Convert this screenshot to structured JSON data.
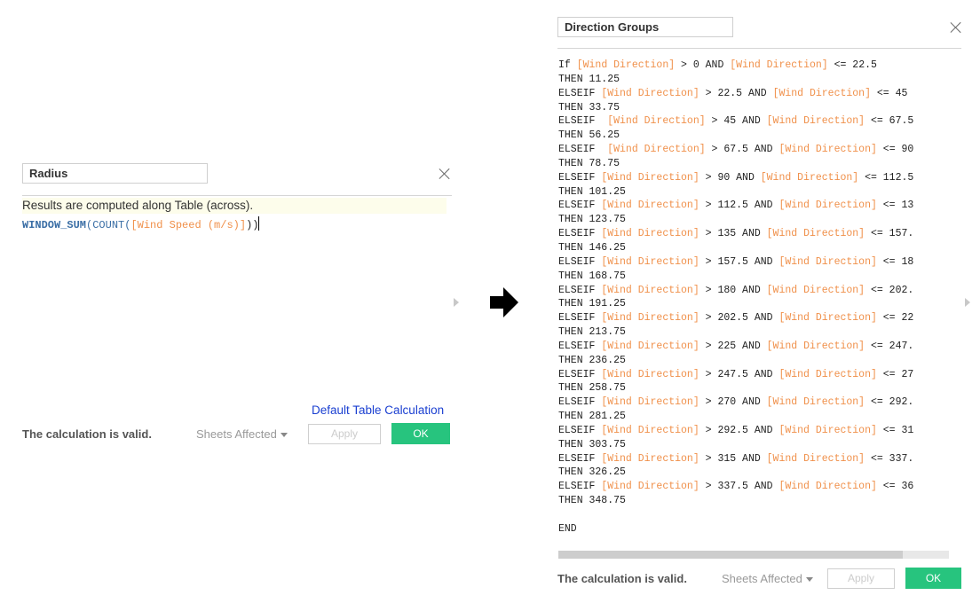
{
  "left_dialog": {
    "name_value": "Radius",
    "hint": "Results are computed along Table (across).",
    "formula": {
      "fn1": "WINDOW_SUM",
      "open1": "(",
      "fn2": "COUNT",
      "open2": "(",
      "field": "[Wind Speed (m/s)]",
      "close": "))"
    },
    "default_table_calc_link": "Default Table Calculation",
    "status": "The calculation is valid.",
    "sheets_affected": "Sheets Affected",
    "apply": "Apply",
    "ok": "OK"
  },
  "right_dialog": {
    "name_value": "Direction Groups",
    "code_lines": [
      [
        {
          "t": "If ",
          "c": "kw"
        },
        {
          "t": "[Wind Direction]",
          "c": "field"
        },
        {
          "t": " > 0 AND ",
          "c": "kw"
        },
        {
          "t": "[Wind Direction]",
          "c": "field"
        },
        {
          "t": " <= 22.5",
          "c": "kw"
        }
      ],
      [
        {
          "t": "THEN 11.25",
          "c": "kw"
        }
      ],
      [
        {
          "t": "ELSEIF ",
          "c": "kw"
        },
        {
          "t": "[Wind Direction]",
          "c": "field"
        },
        {
          "t": " > 22.5 AND ",
          "c": "kw"
        },
        {
          "t": "[Wind Direction]",
          "c": "field"
        },
        {
          "t": " <= 45",
          "c": "kw"
        }
      ],
      [
        {
          "t": "THEN 33.75",
          "c": "kw"
        }
      ],
      [
        {
          "t": "ELSEIF  ",
          "c": "kw"
        },
        {
          "t": "[Wind Direction]",
          "c": "field"
        },
        {
          "t": " > 45 AND ",
          "c": "kw"
        },
        {
          "t": "[Wind Direction]",
          "c": "field"
        },
        {
          "t": " <= 67.5",
          "c": "kw"
        }
      ],
      [
        {
          "t": "THEN 56.25",
          "c": "kw"
        }
      ],
      [
        {
          "t": "ELSEIF  ",
          "c": "kw"
        },
        {
          "t": "[Wind Direction]",
          "c": "field"
        },
        {
          "t": " > 67.5 AND ",
          "c": "kw"
        },
        {
          "t": "[Wind Direction]",
          "c": "field"
        },
        {
          "t": " <= 90",
          "c": "kw"
        }
      ],
      [
        {
          "t": "THEN 78.75",
          "c": "kw"
        }
      ],
      [
        {
          "t": "ELSEIF ",
          "c": "kw"
        },
        {
          "t": "[Wind Direction]",
          "c": "field"
        },
        {
          "t": " > 90 AND ",
          "c": "kw"
        },
        {
          "t": "[Wind Direction]",
          "c": "field"
        },
        {
          "t": " <= 112.5",
          "c": "kw"
        }
      ],
      [
        {
          "t": "THEN 101.25",
          "c": "kw"
        }
      ],
      [
        {
          "t": "ELSEIF ",
          "c": "kw"
        },
        {
          "t": "[Wind Direction]",
          "c": "field"
        },
        {
          "t": " > 112.5 AND ",
          "c": "kw"
        },
        {
          "t": "[Wind Direction]",
          "c": "field"
        },
        {
          "t": " <= 13",
          "c": "kw"
        }
      ],
      [
        {
          "t": "THEN 123.75",
          "c": "kw"
        }
      ],
      [
        {
          "t": "ELSEIF ",
          "c": "kw"
        },
        {
          "t": "[Wind Direction]",
          "c": "field"
        },
        {
          "t": " > 135 AND ",
          "c": "kw"
        },
        {
          "t": "[Wind Direction]",
          "c": "field"
        },
        {
          "t": " <= 157.",
          "c": "kw"
        }
      ],
      [
        {
          "t": "THEN 146.25",
          "c": "kw"
        }
      ],
      [
        {
          "t": "ELSEIF ",
          "c": "kw"
        },
        {
          "t": "[Wind Direction]",
          "c": "field"
        },
        {
          "t": " > 157.5 AND ",
          "c": "kw"
        },
        {
          "t": "[Wind Direction]",
          "c": "field"
        },
        {
          "t": " <= 18",
          "c": "kw"
        }
      ],
      [
        {
          "t": "THEN 168.75",
          "c": "kw"
        }
      ],
      [
        {
          "t": "ELSEIF ",
          "c": "kw"
        },
        {
          "t": "[Wind Direction]",
          "c": "field"
        },
        {
          "t": " > 180 AND ",
          "c": "kw"
        },
        {
          "t": "[Wind Direction]",
          "c": "field"
        },
        {
          "t": " <= 202.",
          "c": "kw"
        }
      ],
      [
        {
          "t": "THEN 191.25",
          "c": "kw"
        }
      ],
      [
        {
          "t": "ELSEIF ",
          "c": "kw"
        },
        {
          "t": "[Wind Direction]",
          "c": "field"
        },
        {
          "t": " > 202.5 AND ",
          "c": "kw"
        },
        {
          "t": "[Wind Direction]",
          "c": "field"
        },
        {
          "t": " <= 22",
          "c": "kw"
        }
      ],
      [
        {
          "t": "THEN 213.75",
          "c": "kw"
        }
      ],
      [
        {
          "t": "ELSEIF ",
          "c": "kw"
        },
        {
          "t": "[Wind Direction]",
          "c": "field"
        },
        {
          "t": " > 225 AND ",
          "c": "kw"
        },
        {
          "t": "[Wind Direction]",
          "c": "field"
        },
        {
          "t": " <= 247.",
          "c": "kw"
        }
      ],
      [
        {
          "t": "THEN 236.25",
          "c": "kw"
        }
      ],
      [
        {
          "t": "ELSEIF ",
          "c": "kw"
        },
        {
          "t": "[Wind Direction]",
          "c": "field"
        },
        {
          "t": " > 247.5 AND ",
          "c": "kw"
        },
        {
          "t": "[Wind Direction]",
          "c": "field"
        },
        {
          "t": " <= 27",
          "c": "kw"
        }
      ],
      [
        {
          "t": "THEN 258.75",
          "c": "kw"
        }
      ],
      [
        {
          "t": "ELSEIF ",
          "c": "kw"
        },
        {
          "t": "[Wind Direction]",
          "c": "field"
        },
        {
          "t": " > 270 AND ",
          "c": "kw"
        },
        {
          "t": "[Wind Direction]",
          "c": "field"
        },
        {
          "t": " <= 292.",
          "c": "kw"
        }
      ],
      [
        {
          "t": "THEN 281.25",
          "c": "kw"
        }
      ],
      [
        {
          "t": "ELSEIF ",
          "c": "kw"
        },
        {
          "t": "[Wind Direction]",
          "c": "field"
        },
        {
          "t": " > 292.5 AND ",
          "c": "kw"
        },
        {
          "t": "[Wind Direction]",
          "c": "field"
        },
        {
          "t": " <= 31",
          "c": "kw"
        }
      ],
      [
        {
          "t": "THEN 303.75",
          "c": "kw"
        }
      ],
      [
        {
          "t": "ELSEIF ",
          "c": "kw"
        },
        {
          "t": "[Wind Direction]",
          "c": "field"
        },
        {
          "t": " > 315 AND ",
          "c": "kw"
        },
        {
          "t": "[Wind Direction]",
          "c": "field"
        },
        {
          "t": " <= 337.",
          "c": "kw"
        }
      ],
      [
        {
          "t": "THEN 326.25",
          "c": "kw"
        }
      ],
      [
        {
          "t": "ELSEIF ",
          "c": "kw"
        },
        {
          "t": "[Wind Direction]",
          "c": "field"
        },
        {
          "t": " > 337.5 AND ",
          "c": "kw"
        },
        {
          "t": "[Wind Direction]",
          "c": "field"
        },
        {
          "t": " <= 36",
          "c": "kw"
        }
      ],
      [
        {
          "t": "THEN 348.75",
          "c": "kw"
        }
      ],
      [
        {
          "t": "",
          "c": "kw"
        }
      ],
      [
        {
          "t": "END",
          "c": "kw"
        }
      ]
    ],
    "status": "The calculation is valid.",
    "sheets_affected": "Sheets Affected",
    "apply": "Apply",
    "ok": "OK"
  },
  "arrow_icon": "right-arrow-icon",
  "colors": {
    "field": "#f0904a",
    "function": "#3a6ea5",
    "ok_button": "#27c47e",
    "link": "#1a3fd1",
    "hint_bg": "#fdfdeb"
  }
}
